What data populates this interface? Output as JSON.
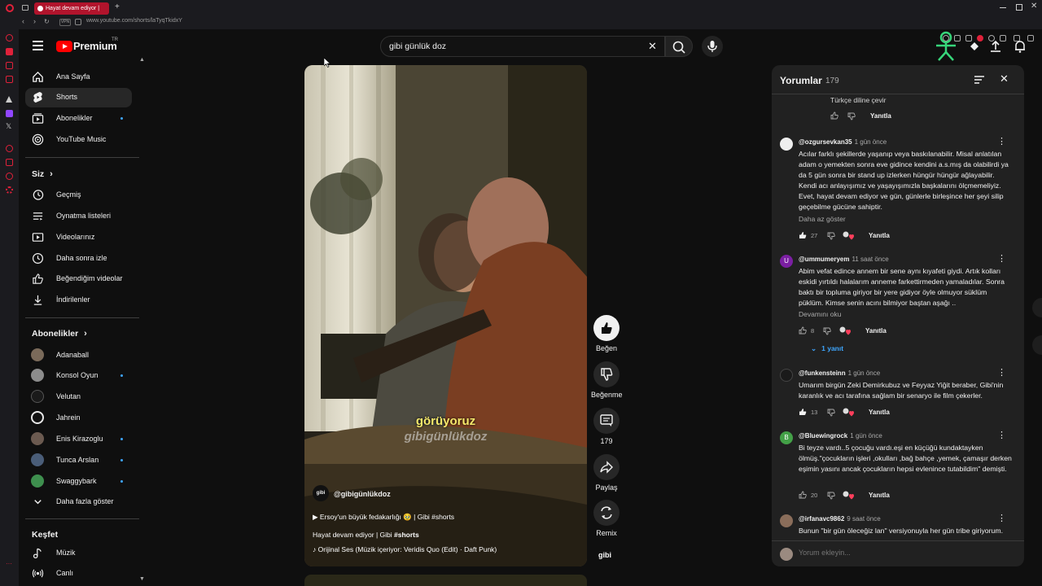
{
  "browser": {
    "tab_title": "Hayat devam ediyor | ",
    "url": "www.youtube.com/shorts/laTyqTkidxY",
    "vpn_label": "VPN"
  },
  "header": {
    "logo_text": "Premium",
    "logo_region": "TR",
    "search_value": "gibi günlük doz"
  },
  "sidebar": {
    "main": [
      {
        "label": "Ana Sayfa",
        "icon": "home-icon"
      },
      {
        "label": "Shorts",
        "icon": "shorts-icon",
        "active": true
      },
      {
        "label": "Abonelikler",
        "icon": "subscriptions-icon"
      },
      {
        "label": "YouTube Music",
        "icon": "youtube-music-icon"
      }
    ],
    "you_heading": "Siz",
    "you": [
      {
        "label": "Geçmiş",
        "icon": "history-icon"
      },
      {
        "label": "Oynatma listeleri",
        "icon": "playlists-icon"
      },
      {
        "label": "Videolarınız",
        "icon": "your-videos-icon"
      },
      {
        "label": "Daha sonra izle",
        "icon": "watch-later-icon"
      },
      {
        "label": "Beğendiğim videolar",
        "icon": "liked-videos-icon"
      },
      {
        "label": "İndirilenler",
        "icon": "downloads-icon"
      }
    ],
    "subs_heading": "Abonelikler",
    "subs": [
      {
        "label": "Adanaball",
        "dot": false
      },
      {
        "label": "Konsol Oyun",
        "dot": true
      },
      {
        "label": "Velutan",
        "dot": false
      },
      {
        "label": "Jahrein",
        "dot": false
      },
      {
        "label": "Enis Kirazoglu",
        "dot": true
      },
      {
        "label": "Tunca Arslan",
        "dot": true
      },
      {
        "label": "Swaggybark",
        "dot": true
      }
    ],
    "show_more": "Daha fazla göster",
    "explore_heading": "Keşfet",
    "explore": [
      {
        "label": "Müzik",
        "icon": "music-icon"
      },
      {
        "label": "Canlı",
        "icon": "live-icon"
      }
    ]
  },
  "video": {
    "caption_main": "görüyoruz",
    "caption_watermark": "gibigünlükdoz",
    "channel_avatar_text": "gibi",
    "channel_handle": "@gibigünlükdoz",
    "related_prefix": "▶",
    "related_title": "Ersoy'un büyük fedakarlığı 🥹 | Gibi #shorts",
    "title_plain": "Hayat devam ediyor | Gibi ",
    "title_hashtag": "#shorts",
    "music_prefix": "♪",
    "music": "Orijinal Ses (Müzik içeriyor: Veridis Quo (Edit) · Daft Punk)"
  },
  "actions": {
    "like": "Beğen",
    "dislike": "Beğenme",
    "comments": "179",
    "share": "Paylaş",
    "remix": "Remix",
    "channel_badge": "gibi"
  },
  "comments_panel": {
    "title": "Yorumlar",
    "count": "179",
    "translate_label": "Türkçe diline çevir",
    "reply_label": "Yanıtla",
    "items": [
      {
        "author": "@ozgursevkan35",
        "time": "1 gün önce",
        "avatar_letter": "",
        "body": "Acılar farklı şekillerde yaşanıp veya baskılanabilir. Misal anlatılan adam o yemekten sonra  eve gidince kendini a.s.mış da olabilirdi ya da 5 gün sonra bir stand up izlerken hüngür hüngür ağlayabilir. Kendi acı anlayışımız ve yaşayışımızla başkalarını ölçmemeliyiz. Evet, hayat devam ediyor ve gün, günlerle birleşince her şeyi silip geçebilme gücüne sahiptir.",
        "more": "Daha az göster",
        "likes": "27"
      },
      {
        "author": "@ummumeryem",
        "time": "11 saat önce",
        "avatar_letter": "U",
        "body": "Abim vefat edince annem bir sene aynı kıyafeti giydi. Artık kolları eskidi yırtıldı halalarım anneme farkettirmeden yamaladılar. Sonra baktı bir topluma giriyor bir yere gidiyor öyle olmuyor süklüm püklüm. Kimse senin acını bilmiyor baştan aşağı ..",
        "more": "Devamını oku",
        "likes": "8",
        "replies": "1 yanıt"
      },
      {
        "author": "@funkensteinn",
        "time": "1 gün önce",
        "avatar_letter": "",
        "body": "Umarım birgün Zeki Demirkubuz ve Feyyaz Yiğit beraber, Gibi'nin karanlık ve acı tarafına sağlam bir senaryo ile film çekerler.",
        "likes": "13"
      },
      {
        "author": "@Bluewingrock",
        "time": "1 gün önce",
        "avatar_letter": "B",
        "body": "Bi teyze vardı..5 çocuğu vardı.eşi en küçüğü kundaktayken ölmüş.\"çocukların işleri ,okulları ,bağ bahçe ,yemek, çamaşır derken eşimin yasını ancak çocukların hepsi evlenince tutabildim\" demişti.",
        "likes": "20"
      },
      {
        "author": "@irfanavc9862",
        "time": "9 saat önce",
        "avatar_letter": "",
        "body": "Bunun \"bir gün öleceğiz lan\" versiyonuyla her gün tribe giriyorum."
      }
    ],
    "input_placeholder": "Yorum ekleyin..."
  },
  "colors": {
    "accent_red": "#ff0000",
    "tab_red": "#b1142c",
    "link_blue": "#3ea6ff",
    "caption_yellow": "#f5e86a",
    "background": "#0f0f0f",
    "panel": "#212121"
  }
}
